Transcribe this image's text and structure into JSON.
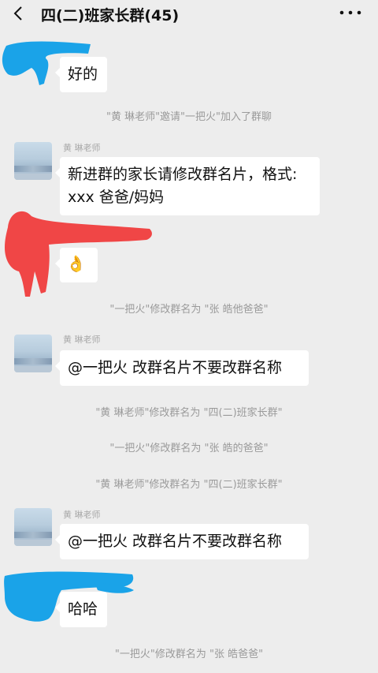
{
  "header": {
    "title": "四(二)班家长群(45)"
  },
  "messages": {
    "m1_text": "好的",
    "sys1": "\"黄 琳老师\"邀请\"一把火\"加入了群聊",
    "m2_sender": "黄 琳老师",
    "m2_line1": "新进群的家长请修改群名片，格式:",
    "m2_line2": "xxx 爸爸/妈妈",
    "m3_emoji": "👌",
    "sys2": "\"一把火\"修改群名为 \"张 皓他爸爸\"",
    "m4_sender": "黄 琳老师",
    "m4_text": "@一把火  改群名片不要改群名称",
    "sys3": "\"黄 琳老师\"修改群名为 \"四(二)班家长群\"",
    "sys4": "\"一把火\"修改群名为 \"张 皓的爸爸\"",
    "sys5": "\"黄 琳老师\"修改群名为 \"四(二)班家长群\"",
    "m5_sender": "黄 琳老师",
    "m5_text": "@一把火  改群名片不要改群名称",
    "m6_text": "哈哈",
    "sys6": "\"一把火\"修改群名为 \"张 皓爸爸\""
  },
  "icons": {
    "back": "chevron-left-icon",
    "more": "more-dots-icon"
  },
  "colors": {
    "background": "#ededed",
    "bubble": "#ffffff",
    "system_text": "#9a9a9a",
    "blue_scribble": "#1aa3e8",
    "red_scribble": "#f04646"
  }
}
